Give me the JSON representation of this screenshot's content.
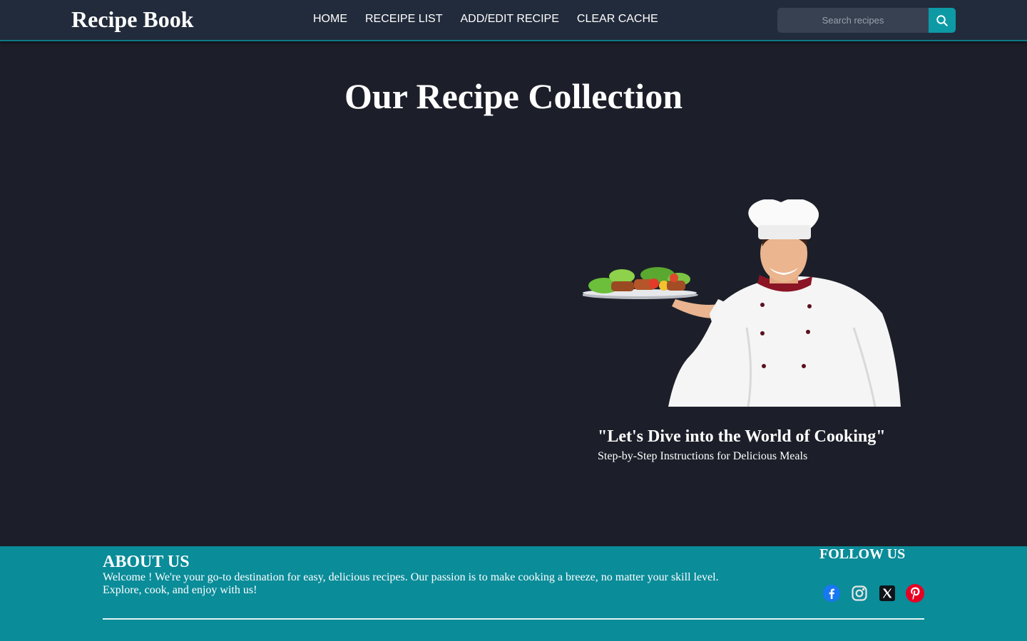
{
  "header": {
    "brand": "Recipe Book",
    "nav": [
      {
        "label": "HOME"
      },
      {
        "label": "RECEIPE LIST"
      },
      {
        "label": "ADD/EDIT RECIPE"
      },
      {
        "label": "CLEAR CACHE"
      }
    ],
    "search": {
      "placeholder": "Search recipes",
      "value": ""
    }
  },
  "main": {
    "title": "Our Recipe Collection",
    "quote": "\"Let's Dive into the World of Cooking\"",
    "tagline": "Step-by-Step Instructions for Delicious Meals"
  },
  "footer": {
    "about_title": "ABOUT US",
    "about_text": "Welcome ! We're your go-to destination for easy, delicious recipes. Our passion is to make cooking a breeze, no matter your skill level. Explore, cook, and enjoy with us!",
    "follow_title": "FOLLOW US",
    "social": [
      {
        "icon": "facebook-icon",
        "color": "#1877f2"
      },
      {
        "icon": "instagram-icon",
        "color": "#e1e1e1"
      },
      {
        "icon": "x-twitter-icon",
        "color": "#000000"
      },
      {
        "icon": "pinterest-icon",
        "color": "#e60023"
      }
    ]
  },
  "colors": {
    "background": "#1c1f29",
    "navbar": "#222b3b",
    "accent": "#0d9aa5",
    "footer": "#0a8c99"
  }
}
